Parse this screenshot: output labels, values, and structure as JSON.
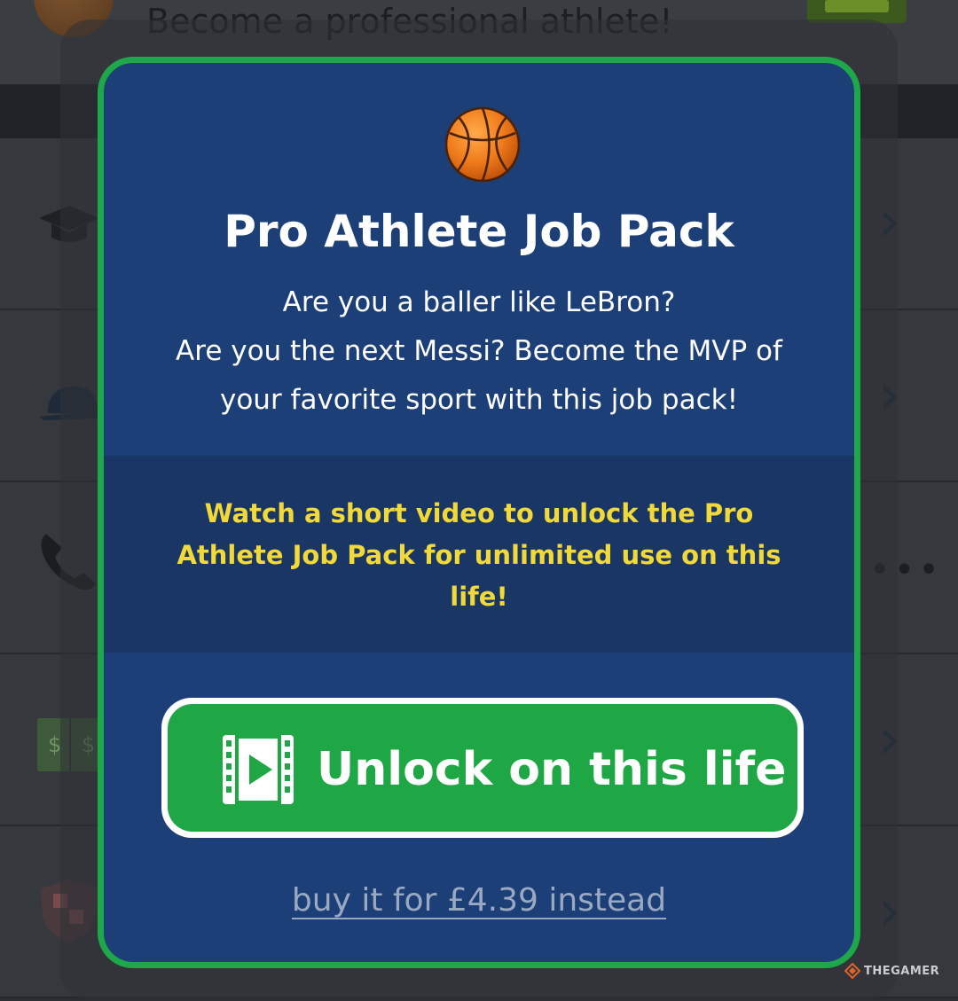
{
  "background": {
    "top_row_text": "Become a professional athlete!"
  },
  "modal": {
    "icon": "basketball-icon",
    "title": "Pro Athlete Job Pack",
    "description_lines": [
      "Are you a baller like LeBron?",
      "Are you the next Messi? Become the MVP of",
      "your favorite sport with this job pack!"
    ],
    "promo_lines": [
      "Watch a short video to unlock the Pro",
      "Athlete Job Pack for unlimited use on this",
      "life!"
    ],
    "unlock_button": {
      "icon": "video-film-icon",
      "label": "Unlock on this life"
    },
    "buy_link": "buy it for £4.39 instead"
  },
  "watermark": "THEGAMER",
  "colors": {
    "modal_bg": "#1d3f78",
    "modal_border": "#1ea84a",
    "promo_text": "#f2d93a",
    "button_green": "#1fa745"
  }
}
